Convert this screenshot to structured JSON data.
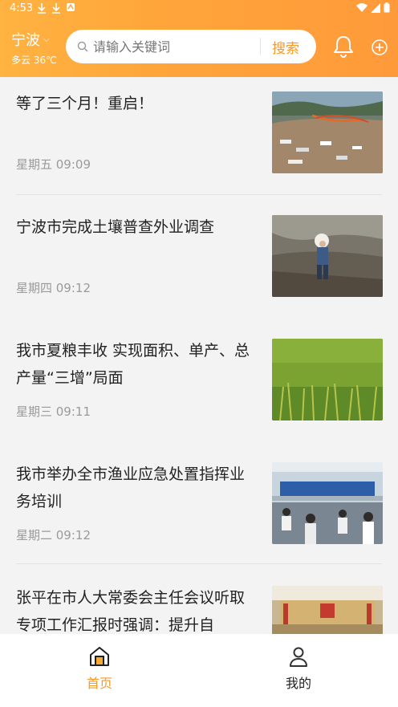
{
  "status_bar": {
    "time": "4:53"
  },
  "header": {
    "city": "宁波",
    "weather": "多云 36℃",
    "search": {
      "placeholder": "请输入关键词",
      "button": "搜索"
    }
  },
  "news": [
    {
      "title": "等了三个月！重启！",
      "time": "星期五 09:09"
    },
    {
      "title": "宁波市完成土壤普查外业调查",
      "time": "星期四 09:12"
    },
    {
      "title": "我市夏粮丰收 实现面积、单产、总产量“三增”局面",
      "time": "星期三 09:11"
    },
    {
      "title": "我市举办全市渔业应急处置指挥业务培训",
      "time": "星期二 09:12"
    },
    {
      "title": "张平在市人大常委会主任会议听取专项工作汇报时强调：提升自",
      "time": ""
    }
  ],
  "bottom_nav": [
    {
      "label": "首页",
      "active": true
    },
    {
      "label": "我的",
      "active": false
    }
  ],
  "colors": {
    "accent": "#f39a2a",
    "header": "#ffa53a",
    "nav_active": "#f39a2a",
    "nav_inactive": "#333333"
  }
}
